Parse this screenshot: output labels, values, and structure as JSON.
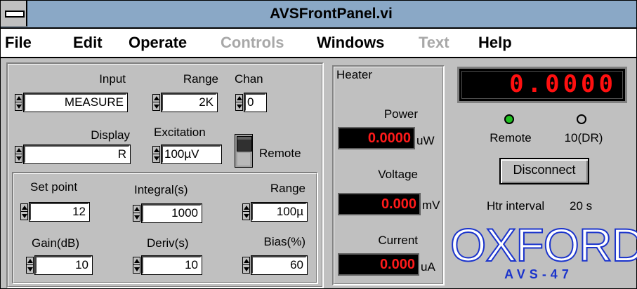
{
  "window": {
    "title": "AVSFrontPanel.vi"
  },
  "menu": [
    {
      "label": "File",
      "disabled": false
    },
    {
      "label": "Edit",
      "disabled": false
    },
    {
      "label": "Operate",
      "disabled": false
    },
    {
      "label": "Controls",
      "disabled": true
    },
    {
      "label": "Windows",
      "disabled": false
    },
    {
      "label": "Text",
      "disabled": true
    },
    {
      "label": "Help",
      "disabled": false
    }
  ],
  "config": {
    "input": {
      "label": "Input",
      "value": "MEASURE"
    },
    "range": {
      "label": "Range",
      "value": "2K"
    },
    "chan": {
      "label": "Chan",
      "value": "0"
    },
    "display": {
      "label": "Display",
      "value": "R"
    },
    "excitation": {
      "label": "Excitation",
      "value": "100µV"
    },
    "remote_toggle": {
      "label": "Remote",
      "state": "off"
    }
  },
  "pid": {
    "setpoint": {
      "label": "Set point",
      "value": "12"
    },
    "integral": {
      "label": "Integral(s)",
      "value": "1000"
    },
    "range": {
      "label": "Range",
      "value": "100µ"
    },
    "gain": {
      "label": "Gain(dB)",
      "value": "10"
    },
    "deriv": {
      "label": "Deriv(s)",
      "value": "10"
    },
    "bias": {
      "label": "Bias(%)",
      "value": "60"
    }
  },
  "heater": {
    "title": "Heater",
    "power": {
      "label": "Power",
      "value": "0.0000",
      "unit": "uW"
    },
    "voltage": {
      "label": "Voltage",
      "value": "0.000",
      "unit": "mV"
    },
    "current": {
      "label": "Current",
      "value": "0.000",
      "unit": "uA"
    }
  },
  "status": {
    "reading": "0.0000",
    "remote_led": {
      "label": "Remote",
      "color": "#20c020",
      "on": true
    },
    "dr_led": {
      "label": "10(DR)",
      "color": "#c0c0c0",
      "on": false
    },
    "disconnect_label": "Disconnect",
    "htr_interval_label": "Htr interval",
    "htr_interval_value": "20 s"
  },
  "logo": {
    "text": "OXFORD",
    "subtext": "AVS-47",
    "color": "#1a33cc"
  },
  "colors": {
    "indicator_red": "#ff1a1a",
    "panel_gray": "#c0c0c0",
    "titlebar": "#8aa8c6"
  }
}
